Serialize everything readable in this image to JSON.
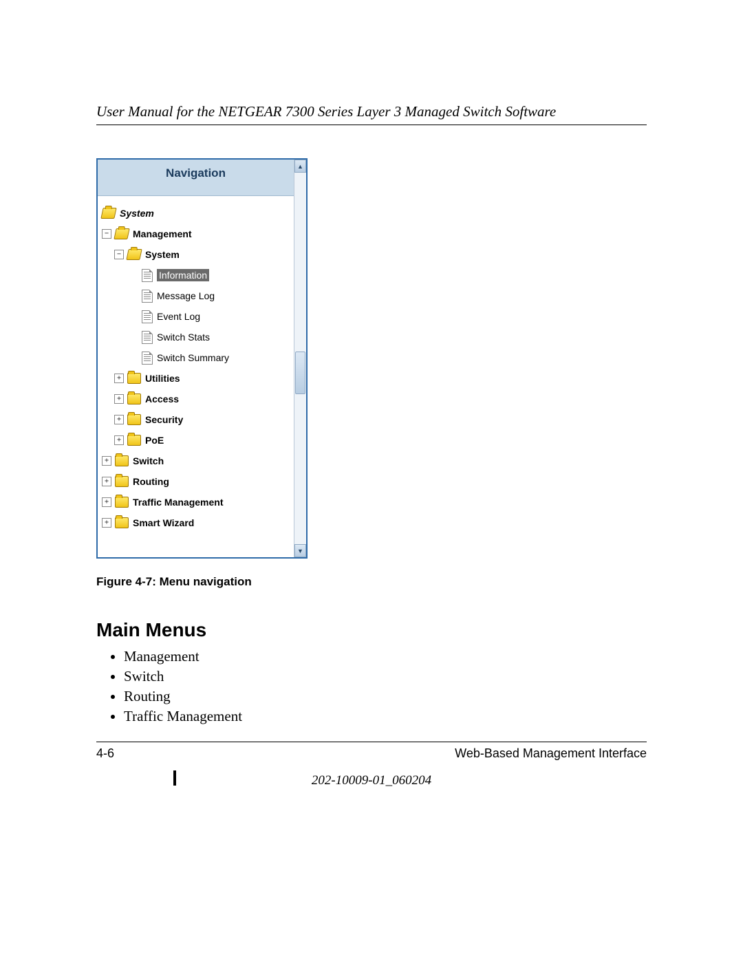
{
  "header": "User Manual for the NETGEAR 7300 Series Layer 3 Managed Switch Software",
  "nav": {
    "title": "Navigation",
    "system": "System",
    "management": "Management",
    "system2": "System",
    "items": {
      "information": "Information",
      "message_log": "Message Log",
      "event_log": "Event Log",
      "switch_stats": "Switch Stats",
      "switch_summary": "Switch Summary"
    },
    "utilities": "Utilities",
    "access": "Access",
    "security": "Security",
    "poe": "PoE",
    "switch": "Switch",
    "routing": "Routing",
    "traffic": "Traffic Management",
    "wizard": "Smart Wizard"
  },
  "caption": "Figure 4-7:  Menu navigation",
  "section": "Main Menus",
  "menus": [
    "Management",
    "Switch",
    "Routing",
    "Traffic Management"
  ],
  "footer": {
    "page": "4-6",
    "section": "Web-Based Management Interface",
    "docid": "202-10009-01_060204"
  }
}
